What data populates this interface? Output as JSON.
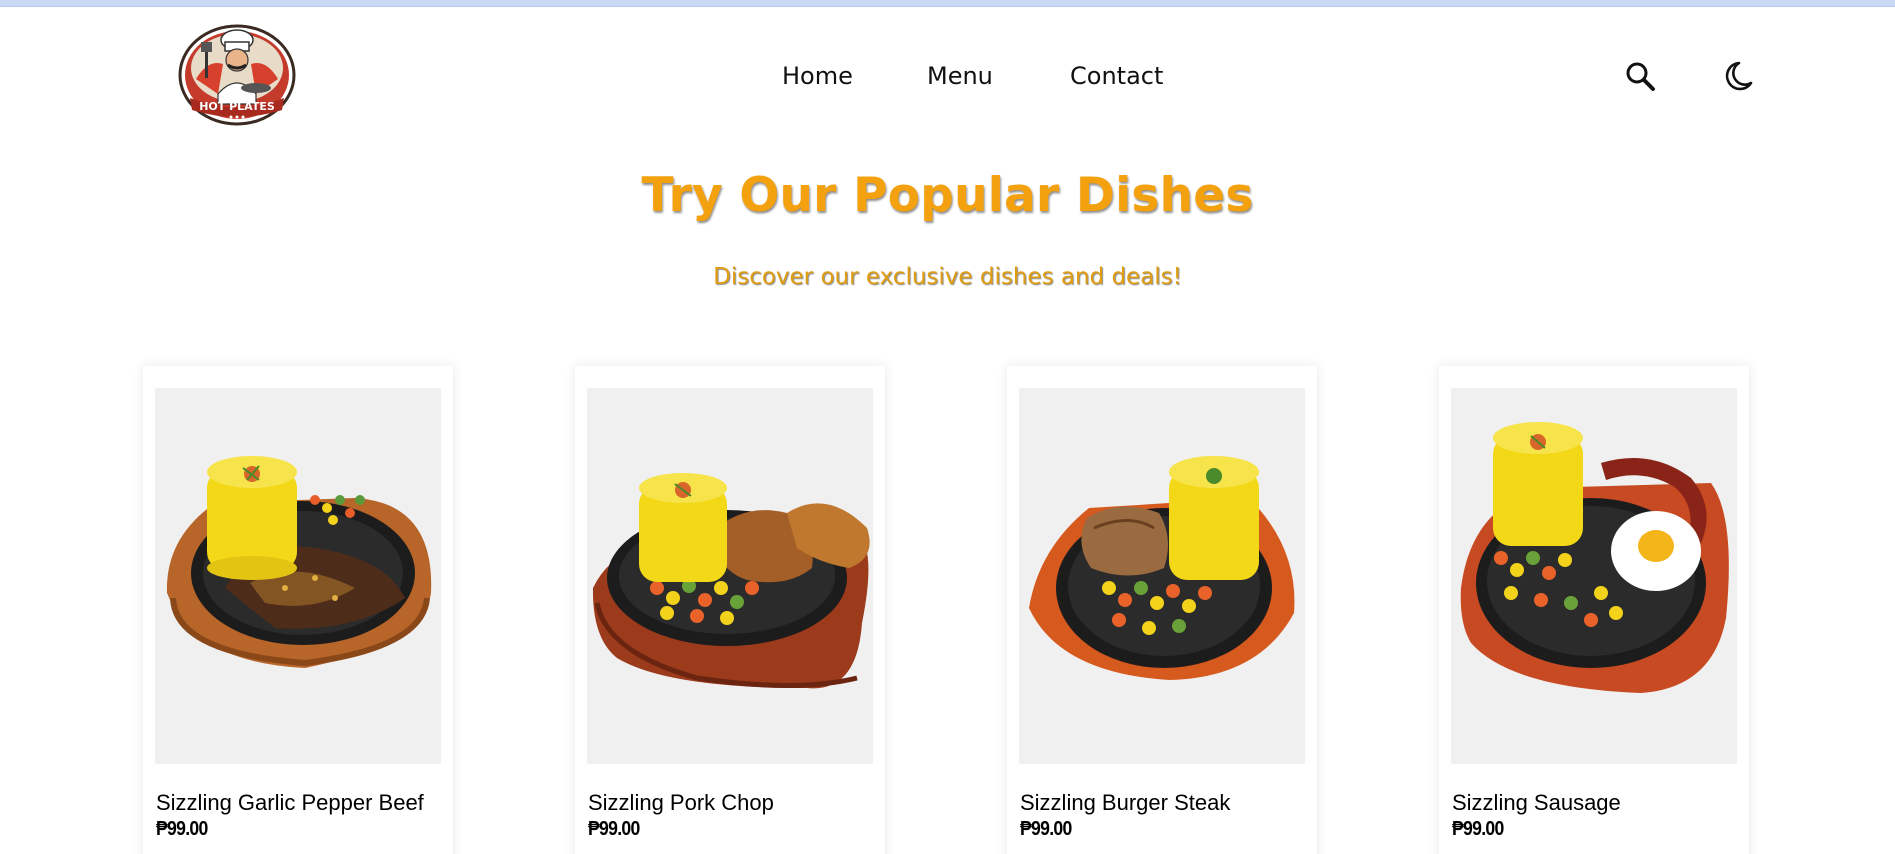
{
  "brand": {
    "logo_text": "HOT PLATES"
  },
  "nav": {
    "home": "Home",
    "menu": "Menu",
    "contact": "Contact"
  },
  "header_icons": [
    "search-icon",
    "moon-icon"
  ],
  "hero": {
    "title": "Try Our Popular Dishes",
    "subtitle": "Discover our exclusive dishes and deals!"
  },
  "dishes": [
    {
      "name": "Sizzling Garlic Pepper Beef",
      "price": "₱99.00"
    },
    {
      "name": "Sizzling Pork Chop",
      "price": "₱99.00"
    },
    {
      "name": "Sizzling Burger Steak",
      "price": "₱99.00"
    },
    {
      "name": "Sizzling Sausage",
      "price": "₱99.00"
    }
  ],
  "colors": {
    "accent": "#f4a10f",
    "subtitle": "#e19d12",
    "card_image_bg": "#f0f0f0"
  }
}
